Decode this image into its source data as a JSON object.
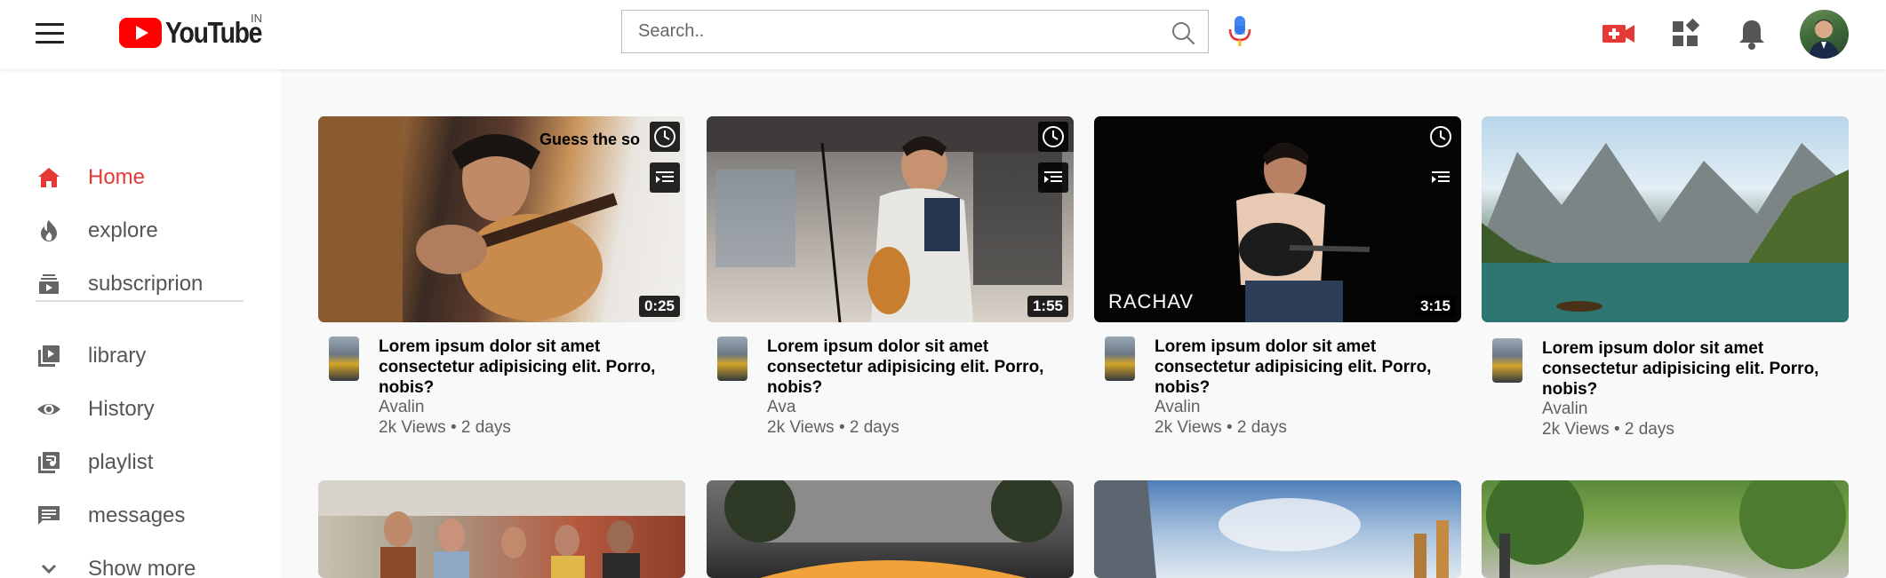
{
  "header": {
    "logo_text": "YouTube",
    "region": "IN",
    "search_placeholder": "Search..",
    "icons": [
      "menu-icon",
      "search-icon",
      "mic-icon",
      "create-video-icon",
      "apps-icon",
      "notifications-icon",
      "avatar"
    ]
  },
  "sidebar": {
    "items": [
      {
        "label": "Home",
        "icon": "home-icon",
        "active": true
      },
      {
        "label": "explore",
        "icon": "explore-icon"
      },
      {
        "label": "subscriprion",
        "icon": "subscriptions-icon"
      },
      {
        "label": "library",
        "icon": "library-icon"
      },
      {
        "label": "History",
        "icon": "history-icon"
      },
      {
        "label": "playlist",
        "icon": "playlist-icon"
      },
      {
        "label": "messages",
        "icon": "messages-icon"
      },
      {
        "label": "Show more",
        "icon": "chevron-down-icon"
      }
    ]
  },
  "videos": [
    {
      "title": "Lorem ipsum dolor sit amet consectetur adipisicing elit. Porro, nobis?",
      "channel": "Avalin",
      "stats": "2k Views • 2 days",
      "duration": "0:25",
      "overlay_text": "Guess the so"
    },
    {
      "title": "Lorem ipsum dolor sit amet consectetur adipisicing elit. Porro, nobis?",
      "channel": "Ava",
      "stats": "2k Views • 2 days",
      "duration": "1:55"
    },
    {
      "title": "Lorem ipsum dolor sit amet consectetur adipisicing elit. Porro, nobis?",
      "channel": "Avalin",
      "stats": "2k Views • 2 days",
      "duration": "3:15",
      "brand_text": "RACHAV"
    },
    {
      "title": "Lorem ipsum dolor sit amet consectetur adipisicing elit. Porro, nobis?",
      "channel": "Avalin",
      "stats": "2k Views • 2 days"
    }
  ],
  "colors": {
    "accent": "#e53935",
    "youtube_red": "#ff0000",
    "mic_blue": "#4285f4",
    "background": "#f9f9f9"
  }
}
